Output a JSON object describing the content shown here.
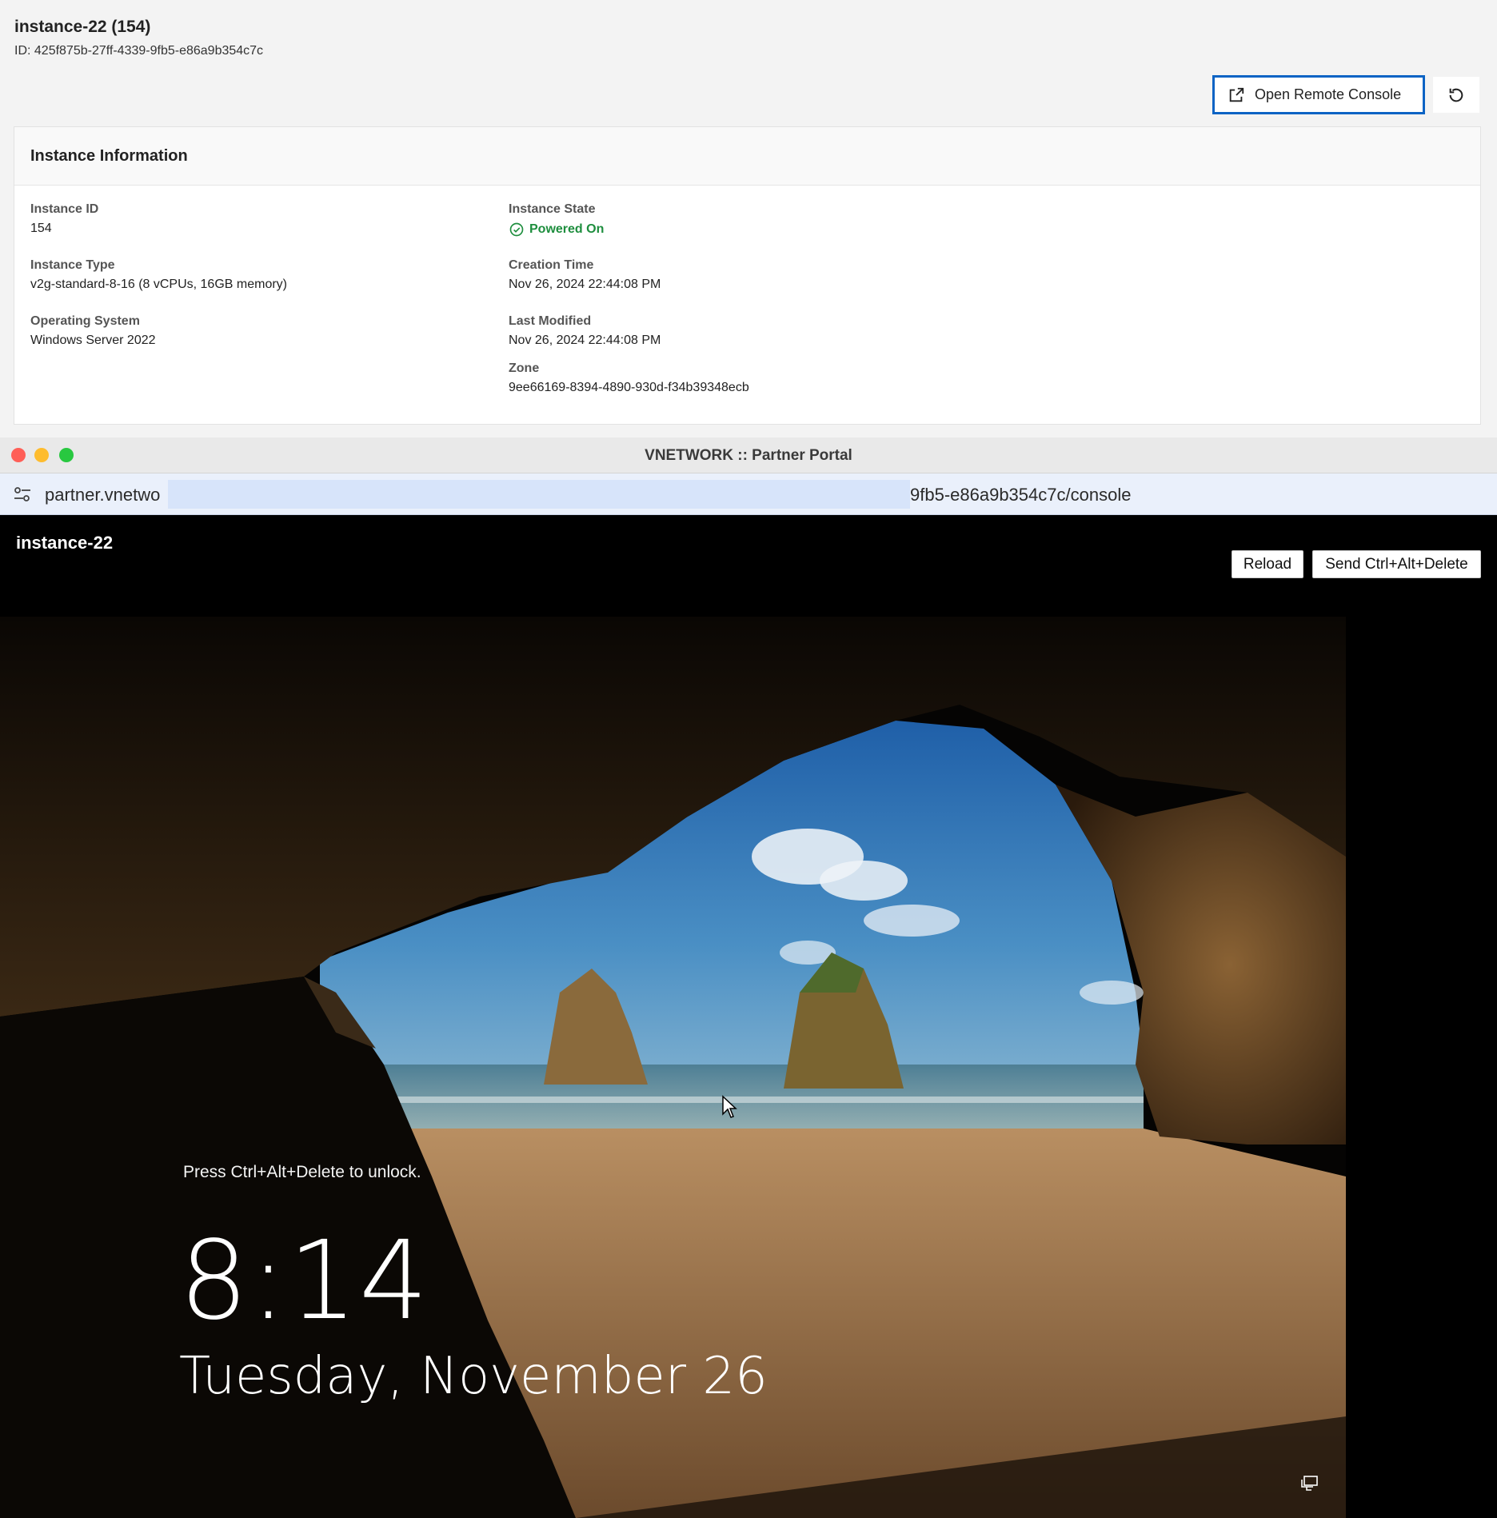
{
  "header": {
    "title": "instance-22 (154)",
    "subtitle": "ID: 425f875b-27ff-4339-9fb5-e86a9b354c7c",
    "open_console_label": "Open Remote Console"
  },
  "card": {
    "title": "Instance Information",
    "fields": {
      "instance_id": {
        "label": "Instance ID",
        "value": "154"
      },
      "instance_type": {
        "label": "Instance Type",
        "value": "v2g-standard-8-16 (8 vCPUs, 16GB memory)"
      },
      "os": {
        "label": "Operating System",
        "value": "Windows Server 2022"
      },
      "state": {
        "label": "Instance State",
        "value": "Powered On"
      },
      "creation": {
        "label": "Creation Time",
        "value": "Nov 26, 2024 22:44:08 PM"
      },
      "modified": {
        "label": "Last Modified",
        "value": "Nov 26, 2024 22:44:08 PM"
      },
      "zone": {
        "label": "Zone",
        "value": "9ee66169-8394-4890-930d-f34b39348ecb"
      }
    }
  },
  "browser": {
    "window_title": "VNETWORK :: Partner Portal",
    "url_start": "partner.vnetwo",
    "url_end": "9fb5-e86a9b354c7c/console"
  },
  "console": {
    "title": "instance-22",
    "reload_label": "Reload",
    "cad_label": "Send Ctrl+Alt+Delete",
    "lock_message": "Press Ctrl+Alt+Delete to unlock.",
    "time": "8:14",
    "date": "Tuesday, November 26"
  },
  "colors": {
    "accent": "#0b63c4",
    "status_green": "#1e8e3e"
  }
}
